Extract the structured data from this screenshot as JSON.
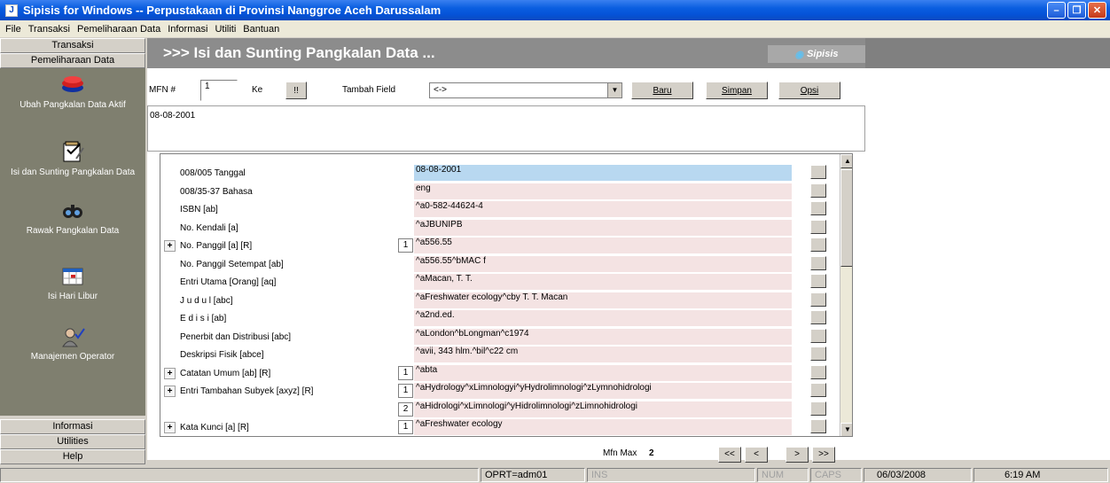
{
  "window": {
    "title": "Sipisis for Windows -- Perpustakaan di Provinsi Nanggroe Aceh Darussalam",
    "app_icon": "J"
  },
  "menu": [
    "File",
    "Transaksi",
    "Pemeliharaan Data",
    "Informasi",
    "Utiliti",
    "Bantuan"
  ],
  "sidebar": {
    "header_top": "Transaksi",
    "header_active": "Pemeliharaan Data",
    "items": [
      {
        "label": "Ubah Pangkalan Data Aktif",
        "icon": "database-stack-icon"
      },
      {
        "label": "Isi dan Sunting Pangkalan Data",
        "icon": "edit-form-icon"
      },
      {
        "label": "Rawak Pangkalan Data",
        "icon": "binoculars-icon"
      },
      {
        "label": "Isi Hari Libur",
        "icon": "calendar-icon"
      },
      {
        "label": "Manajemen Operator",
        "icon": "operator-icon"
      }
    ],
    "bottom": [
      "Informasi",
      "Utilities",
      "Help"
    ]
  },
  "main": {
    "title": ">>> Isi dan Sunting Pangkalan Data ...",
    "brand": "Sipisis",
    "mfn_label": "MFN #",
    "mfn_value": "1",
    "ke_label": "Ke",
    "go_label": "!!",
    "tambah_label": "Tambah Field",
    "field_select": "<->",
    "baru": "Baru",
    "simpan": "Simpan",
    "opsi": "Opsi",
    "preview_text": "08-08-2001",
    "mfn_max_label": "Mfn Max",
    "mfn_max_value": "2",
    "nav": [
      "<<",
      "<",
      ">",
      ">>"
    ]
  },
  "fields": [
    {
      "label": "008/005 Tanggal",
      "value": "08-08-2001",
      "plus": false,
      "idx": "",
      "selected": true
    },
    {
      "label": "008/35-37 Bahasa",
      "value": "eng",
      "plus": false,
      "idx": ""
    },
    {
      "label": "ISBN [ab]",
      "value": "^a0-582-44624-4",
      "plus": false,
      "idx": ""
    },
    {
      "label": "No. Kendali [a]",
      "value": "^aJBUNIPB",
      "plus": false,
      "idx": ""
    },
    {
      "label": "No. Panggil [a] [R]",
      "value": "^a556.55",
      "plus": true,
      "idx": "1"
    },
    {
      "label": "No. Panggil Setempat [ab]",
      "value": "^a556.55^bMAC f",
      "plus": false,
      "idx": ""
    },
    {
      "label": "Entri Utama [Orang] [aq]",
      "value": "^aMacan, T. T.",
      "plus": false,
      "idx": ""
    },
    {
      "label": "J u d u l [abc]",
      "value": "^aFreshwater ecology^cby T. T. Macan",
      "plus": false,
      "idx": ""
    },
    {
      "label": "E d i s i [ab]",
      "value": "^a2nd.ed.",
      "plus": false,
      "idx": ""
    },
    {
      "label": "Penerbit dan Distribusi [abc]",
      "value": "^aLondon^bLongman^c1974",
      "plus": false,
      "idx": ""
    },
    {
      "label": "Deskripsi Fisik [abce]",
      "value": "^avii, 343 hlm.^bil^c22 cm",
      "plus": false,
      "idx": ""
    },
    {
      "label": "Catatan Umum [ab] [R]",
      "value": "^abta",
      "plus": true,
      "idx": "1"
    },
    {
      "label": "Entri Tambahan Subyek [axyz] [R]",
      "value": "^aHydrology^xLimnologyi^yHydrolimnologi^zLymnohidrologi",
      "plus": true,
      "idx": "1"
    },
    {
      "label": "",
      "value": "^aHidrologi^xLimnologi^yHidrolimnologi^zLimnohidrologi",
      "plus": false,
      "idx": "2"
    },
    {
      "label": "Kata Kunci [a] [R]",
      "value": "^aFreshwater ecology",
      "plus": true,
      "idx": "1"
    }
  ],
  "status": {
    "operator": "OPRT=adm01",
    "ins": "INS",
    "num": "NUM",
    "caps": "CAPS",
    "date": "06/03/2008",
    "time": "6:19 AM"
  }
}
